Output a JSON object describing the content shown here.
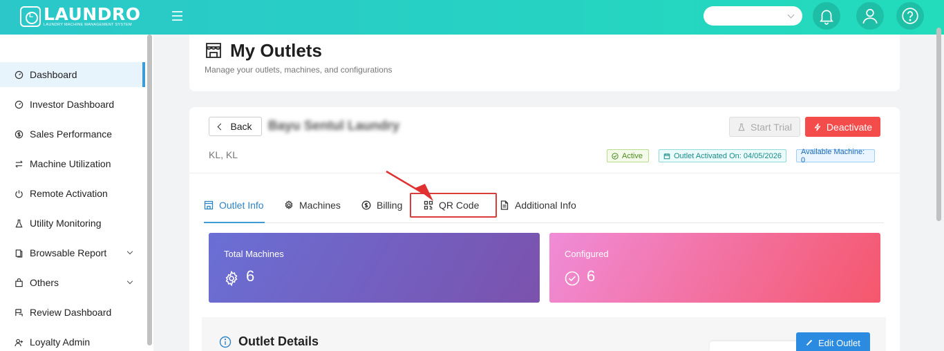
{
  "header": {
    "logo_word": "LAUNDRO",
    "logo_tagline": "LAUNDRY MACHINE MANAGEMENT SYSTEM",
    "outlet_select_value": ""
  },
  "sidebar": {
    "items": [
      {
        "label": "Dashboard",
        "icon": "dashboard-icon"
      },
      {
        "label": "Investor Dashboard",
        "icon": "dashboard-icon"
      },
      {
        "label": "Sales Performance",
        "icon": "dollar-icon"
      },
      {
        "label": "Machine Utilization",
        "icon": "swap-icon"
      },
      {
        "label": "Remote Activation",
        "icon": "power-icon"
      },
      {
        "label": "Utility Monitoring",
        "icon": "flask-icon"
      },
      {
        "label": "Browsable Report",
        "icon": "report-icon"
      },
      {
        "label": "Others",
        "icon": "bag-icon"
      },
      {
        "label": "Review Dashboard",
        "icon": "review-icon"
      },
      {
        "label": "Loyalty Admin",
        "icon": "user-plus-icon"
      }
    ]
  },
  "page": {
    "title": "My Outlets",
    "subtitle": "Manage your outlets, machines, and configurations"
  },
  "outlet": {
    "back_label": "Back",
    "name": "Bayu Sentul Laundry",
    "location": "KL, KL",
    "start_trial_label": "Start Trial",
    "deactivate_label": "Deactivate",
    "status_tag": "Active",
    "activated_tag": "Outlet Activated On: 04/05/2026",
    "available_tag": "Available Machine: 0"
  },
  "tabs": [
    {
      "label": "Outlet Info"
    },
    {
      "label": "Machines"
    },
    {
      "label": "Billing"
    },
    {
      "label": "QR Code"
    },
    {
      "label": "Additional Info"
    }
  ],
  "stats": {
    "total_label": "Total Machines",
    "total_value": "6",
    "configured_label": "Configured",
    "configured_value": "6"
  },
  "details": {
    "title": "Outlet Details",
    "edit_label": "Edit Outlet"
  },
  "colors": {
    "header_gradient_start": "#2bc7c9",
    "accent_blue": "#3d9bd6",
    "danger": "#f44b4b",
    "highlight_red": "#d93a3a"
  }
}
